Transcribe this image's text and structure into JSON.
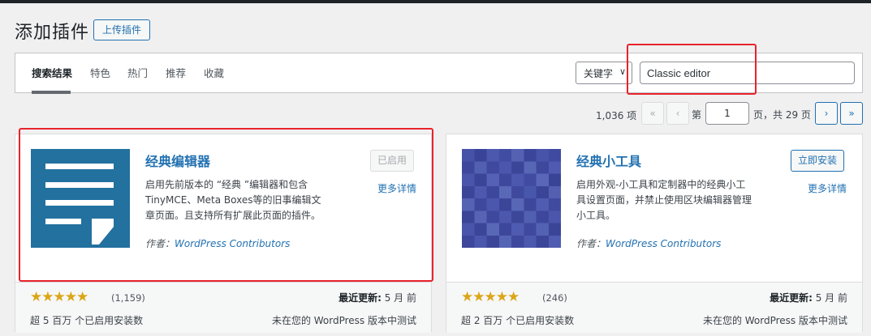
{
  "header": {
    "title": "添加插件",
    "upload_label": "上传插件"
  },
  "filters": {
    "tabs": [
      "搜索结果",
      "特色",
      "热门",
      "推荐",
      "收藏"
    ],
    "search_type": "关键字",
    "search_value": "Classic editor"
  },
  "pagination": {
    "items": "1,036 项",
    "first": "«",
    "prev": "‹",
    "page_prefix": "第",
    "current_page": "1",
    "page_suffix": "页，共 29 页",
    "next": "›",
    "last": "»"
  },
  "plugins": [
    {
      "name": "经典编辑器",
      "action": "已启用",
      "more": "更多详情",
      "desc": "启用先前版本的 “经典 ”编辑器和包含TinyMCE、Meta Boxes等的旧事编辑文章页面。且支持所有扩展此页面的插件。",
      "author_prefix": "作者：",
      "author": "WordPress Contributors",
      "stars": "★★★★★",
      "rating_count": "(1,159)",
      "installs": "超 5 百万 个已启用安装数",
      "updated_label": "最近更新:",
      "updated_value": "5 月 前",
      "compat": "未在您的 WordPress 版本中测试"
    },
    {
      "name": "经典小工具",
      "action": "立即安装",
      "more": "更多详情",
      "desc": "启用外观-小工具和定制器中的经典小工具设置页面，并禁止使用区块编辑器管理小工具。",
      "author_prefix": "作者：",
      "author": "WordPress Contributors",
      "stars": "★★★★★",
      "rating_count": "(246)",
      "installs": "超 2 百万 个已启用安装数",
      "updated_label": "最近更新:",
      "updated_value": "5 月 前",
      "compat": "未在您的 WordPress 版本中测试"
    }
  ],
  "colors": {
    "accent": "#2271b1",
    "highlight": "#e8232b",
    "editor_icon_bg": "#22719f",
    "star": "#dba617"
  }
}
